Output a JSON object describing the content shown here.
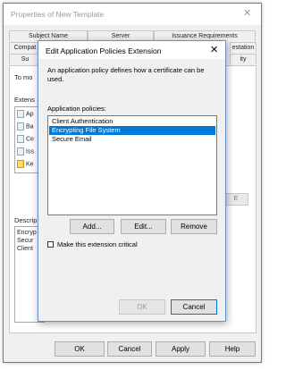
{
  "outer_window": {
    "title": "Properties of New Template",
    "close_glyph": "✕",
    "tabs_row1": [
      "Subject Name",
      "Server",
      "Issuance Requirements"
    ],
    "tabs_row2_left": "Compat",
    "tabs_row2_right": "estation",
    "tabs_row3_left": "Su",
    "tabs_row3_right": "ity",
    "instruction": "To mo",
    "extensions_label": "Extens",
    "extensions": [
      "Ap",
      "Ba",
      "Ce",
      "Iss",
      "Ke"
    ],
    "edit_button": "E",
    "description_label": "Descrip",
    "description_lines": [
      "Encryp",
      "Secur",
      "Client"
    ],
    "buttons": {
      "ok": "OK",
      "cancel": "Cancel",
      "apply": "Apply",
      "help": "Help"
    }
  },
  "dialog": {
    "title": "Edit Application Policies Extension",
    "close_glyph": "✕",
    "description": "An application policy defines how a certificate can be used.",
    "policies_label": "Application policies:",
    "policies": [
      "Client Authentication",
      "Encrypting File System",
      "Secure Email"
    ],
    "selected_index": 1,
    "buttons": {
      "add": "Add...",
      "edit": "Edit...",
      "remove": "Remove",
      "ok": "OK",
      "cancel": "Cancel"
    },
    "critical_checkbox": {
      "label": "Make this extension critical",
      "checked": false
    }
  },
  "colors": {
    "selection": "#0078d7",
    "dialog_border": "#6a8fcf"
  }
}
